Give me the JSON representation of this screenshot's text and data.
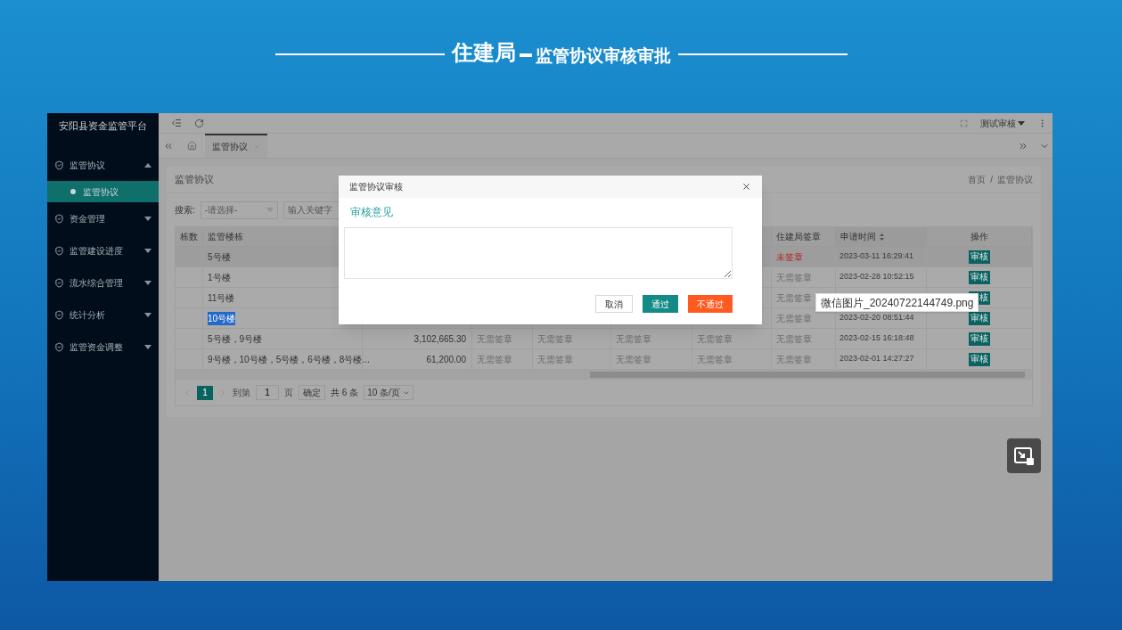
{
  "slide_title": {
    "main": "住建局",
    "sub": "监管协议审核审批"
  },
  "sidebar": {
    "title": "安阳县资金监管平台",
    "items": [
      {
        "label": "监管协议",
        "expanded": true,
        "children": [
          {
            "label": "监管协议",
            "selected": true
          }
        ]
      },
      {
        "label": "资金管理",
        "expanded": false
      },
      {
        "label": "监管建设进度",
        "expanded": false
      },
      {
        "label": "流水综合管理",
        "expanded": false
      },
      {
        "label": "统计分析",
        "expanded": false
      },
      {
        "label": "监管资金调整",
        "expanded": false
      }
    ]
  },
  "topbar": {
    "user": "测试审核"
  },
  "tabs": [
    {
      "label": "监管协议",
      "selected": true
    }
  ],
  "page": {
    "title": "监管协议",
    "breadcrumb": [
      "首页",
      "监管协议"
    ],
    "breadcrumb_separator": "/",
    "search": {
      "label": "搜索:",
      "select_placeholder": "-请选择-",
      "keyword_placeholder": "输入关键字"
    }
  },
  "table": {
    "columns_left": [
      "栋数",
      "监管楼栋"
    ],
    "columns_right": [
      {
        "label": "住建局签章",
        "sortable": false
      },
      {
        "label": "申请时间",
        "sortable": true
      },
      {
        "label": "操作",
        "sortable": false
      }
    ],
    "rows": [
      {
        "name": "5号楼",
        "name_highlighted": false,
        "selected": true,
        "zjj_sign": {
          "text": "未签章",
          "kind": "unsigned"
        },
        "time": "2023-03-11 16:29:41",
        "action": "审核"
      },
      {
        "name": "1号楼",
        "name_highlighted": false,
        "selected": false,
        "zjj_sign": {
          "text": "无需签章",
          "kind": "not_needed"
        },
        "time": "2023-02-28 10:52:15",
        "action": "审核"
      },
      {
        "name": "11号楼",
        "name_highlighted": false,
        "selected": false,
        "zjj_sign": {
          "text": "无需签章",
          "kind": "not_needed"
        },
        "action": "核"
      },
      {
        "name": "10号楼",
        "name_highlighted": true,
        "selected": false,
        "zjj_sign": {
          "text": "无需签章",
          "kind": "not_needed"
        },
        "time": "2023-02-20 08:51:44",
        "action": "审核"
      },
      {
        "name": "5号楼，9号楼",
        "name_highlighted": false,
        "selected": false,
        "amount": "3,102,665.30",
        "sig_cols": [
          "无需签章",
          "无需签章",
          "无需签章",
          "无需签章"
        ],
        "zjj_sign": {
          "text": "无需签章",
          "kind": "not_needed"
        },
        "time": "2023-02-15 16:18:48",
        "action": "审核"
      },
      {
        "name": "9号楼，10号楼，5号楼，6号楼，8号楼...",
        "name_highlighted": false,
        "selected": false,
        "amount": "61,200.00",
        "sig_cols": [
          "无需签章",
          "无需签章",
          "无需签章",
          "无需签章"
        ],
        "zjj_sign": {
          "text": "无需签章",
          "kind": "not_needed"
        },
        "time": "2023-02-01 14:27:27",
        "action": "审核"
      }
    ]
  },
  "pagination": {
    "pages": [
      {
        "label": "1",
        "selected": true
      }
    ],
    "goto_label": "到第",
    "goto_value": "1",
    "page_unit": "页",
    "confirm": "确定",
    "total": "共 6 条",
    "page_size": "10 条/页"
  },
  "dialog": {
    "title": "监管协议审核",
    "heading": "审核意见",
    "buttons": [
      {
        "label": "取消",
        "kind": "default"
      },
      {
        "label": "通过",
        "kind": "primary"
      },
      {
        "label": "不通过",
        "kind": "danger"
      }
    ]
  },
  "tooltip": "微信图片_20240722144749.png"
}
